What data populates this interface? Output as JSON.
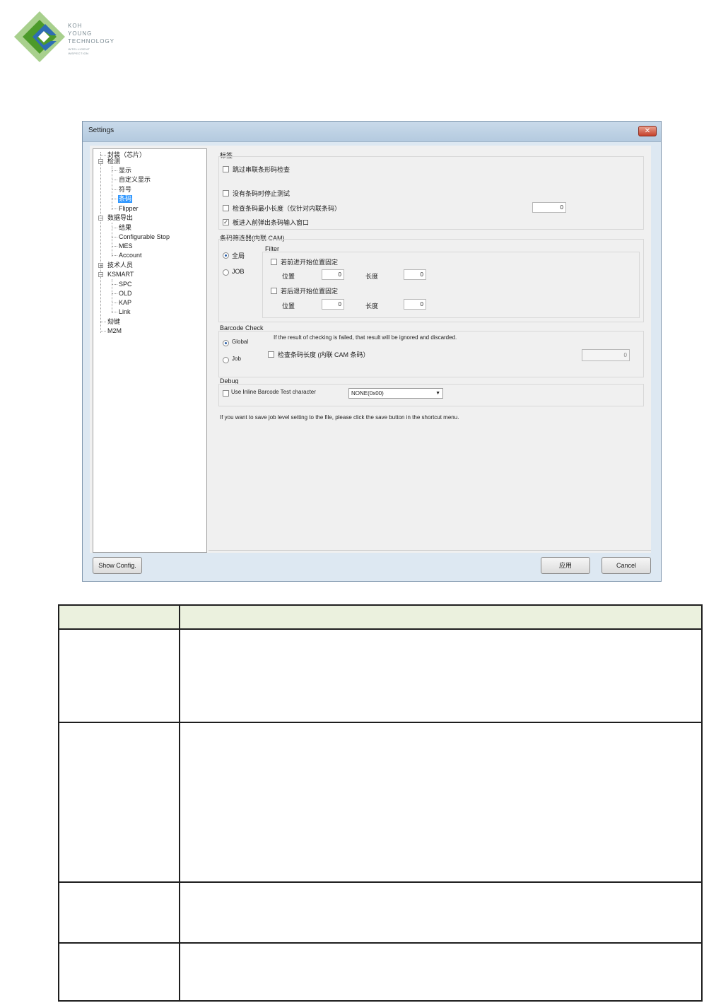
{
  "logo": {
    "line1": "KOH",
    "line2": "YOUNG",
    "line3": "TECHNOLOGY",
    "tagline1": "INTELLIGENT",
    "tagline2": "INSPECTION",
    "colors": {
      "light_green": "#a8d08d",
      "dark_green": "#4c9a2a",
      "blue": "#2e6db4"
    }
  },
  "window": {
    "title": "Settings",
    "close_glyph": "✕"
  },
  "tree": {
    "items": [
      "封装（芯片）",
      "检测",
      "显示",
      "自定义显示",
      "符号",
      "条码",
      "Flipper",
      "数据导出",
      "结果",
      "Configurable Stop",
      "MES",
      "Account",
      "技术人员",
      "KSMART",
      "SPC",
      "OLD",
      "KAP",
      "Link",
      "劾键",
      "M2M"
    ],
    "selected": "条码",
    "expander_minus": "−",
    "expander_plus": "+"
  },
  "panel": {
    "group_label": "标签",
    "skip_serial": "跳过串联条形码检查",
    "stop_no_barcode": "没有条码时停止测试",
    "check_min_length": "检查条码最小长度（仅针对内联条码）",
    "min_length_value": "0",
    "popup_input": "板进入前弹出条码输入窗口",
    "filter_group_label": "条码筛选器(内联 CAM)",
    "radio_global_cn": "全局",
    "radio_job": "JOB",
    "filter_label": "Filter",
    "front_fix": "若前进开始位置固定",
    "back_fix": "若后退开始位置固定",
    "position": "位置",
    "length": "长度",
    "front_pos": "0",
    "front_len": "0",
    "back_pos": "0",
    "back_len": "0",
    "barcode_check_label": "Barcode Check",
    "barcode_check_desc": "If the result of checking is failed, that result will be ignored and discarded.",
    "radio_global": "Global",
    "radio_job2": "Job",
    "check_length_cam": "检查条码长度  (内联 CAM 条码）",
    "cam_length_value": "0",
    "debug_label": "Debug",
    "use_inline_test": "Use Inline Barcode Test character",
    "test_char_value": "NONE(0x00)",
    "combo_arrow": "▼",
    "check_mark": "✓",
    "footer_note": "If you want to save job level setting to the file, please click the save button in the shortcut menu."
  },
  "buttons": {
    "show_config": "Show Config.",
    "apply": "应用",
    "cancel": "Cancel"
  },
  "table": {
    "header_color": "#ebf1de"
  }
}
